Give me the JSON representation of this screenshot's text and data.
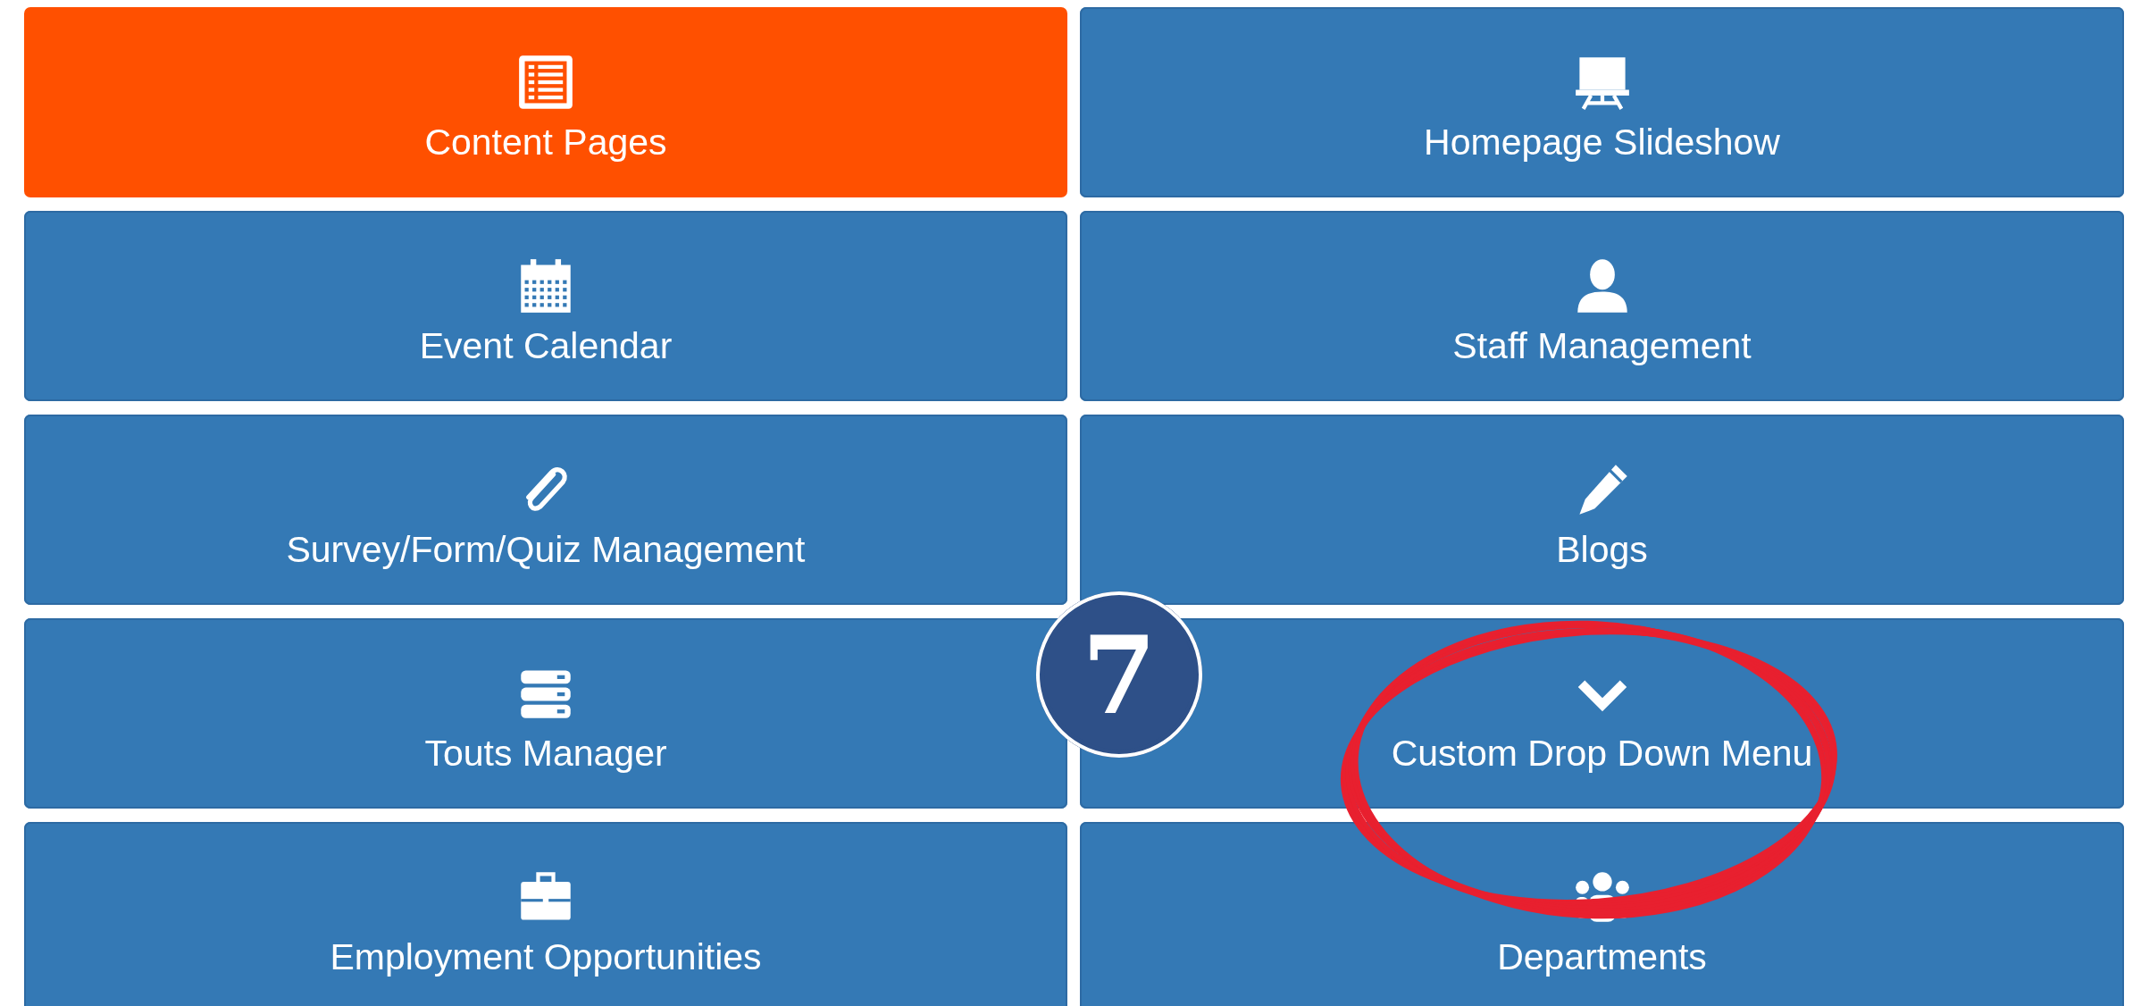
{
  "tiles": [
    {
      "label": "Content Pages",
      "selected": true
    },
    {
      "label": "Homepage Slideshow",
      "selected": false
    },
    {
      "label": "Event Calendar",
      "selected": false
    },
    {
      "label": "Staff Management",
      "selected": false
    },
    {
      "label": "Survey/Form/Quiz Management",
      "selected": false
    },
    {
      "label": "Blogs",
      "selected": false
    },
    {
      "label": "Touts Manager",
      "selected": false
    },
    {
      "label": "Custom Drop Down Menu",
      "selected": false
    },
    {
      "label": "Employment Opportunities",
      "selected": false
    },
    {
      "label": "Departments",
      "selected": false
    }
  ],
  "step_badge": "7"
}
